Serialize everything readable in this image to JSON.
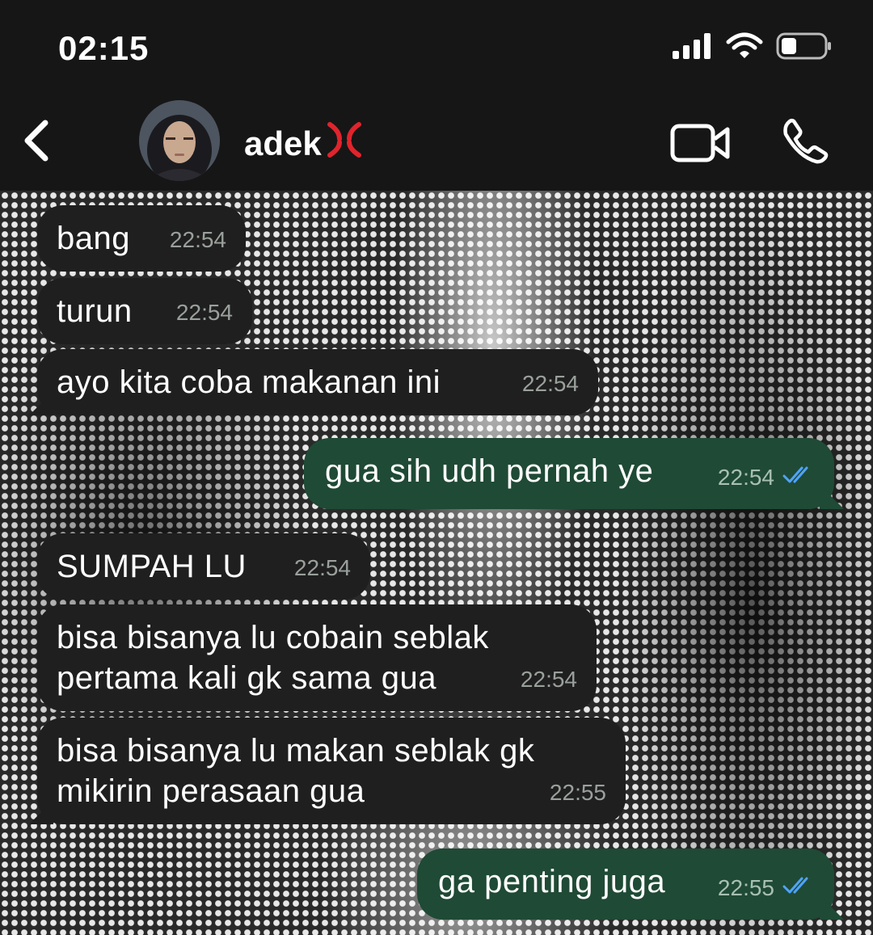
{
  "status_bar": {
    "time": "02:15",
    "icons": [
      "signal-icon",
      "wifi-icon",
      "battery-icon"
    ]
  },
  "header": {
    "contact_name": "adek",
    "name_emoji": "💢",
    "buttons": [
      "back-icon",
      "video-call-icon",
      "phone-call-icon"
    ]
  },
  "colors": {
    "incoming_bubble": "#1f1f1f",
    "outgoing_bubble": "#1f4a35",
    "read_receipt": "#4fa3ff"
  },
  "messages": [
    {
      "direction": "in",
      "text": "bang",
      "time": "22:54"
    },
    {
      "direction": "in",
      "text": "turun",
      "time": "22:54"
    },
    {
      "direction": "in",
      "text": "ayo kita coba makanan ini",
      "time": "22:54"
    },
    {
      "direction": "out",
      "text": "gua sih udh pernah ye",
      "time": "22:54",
      "status": "read"
    },
    {
      "direction": "in",
      "text": "SUMPAH LU",
      "time": "22:54"
    },
    {
      "direction": "in",
      "text": "bisa bisanya lu cobain seblak\npertama kali gk sama gua",
      "time": "22:54"
    },
    {
      "direction": "in",
      "text": "bisa bisanya lu makan seblak gk\nmikirin perasaan gua",
      "time": "22:55"
    },
    {
      "direction": "out",
      "text": "ga penting juga",
      "time": "22:55",
      "status": "read"
    }
  ]
}
